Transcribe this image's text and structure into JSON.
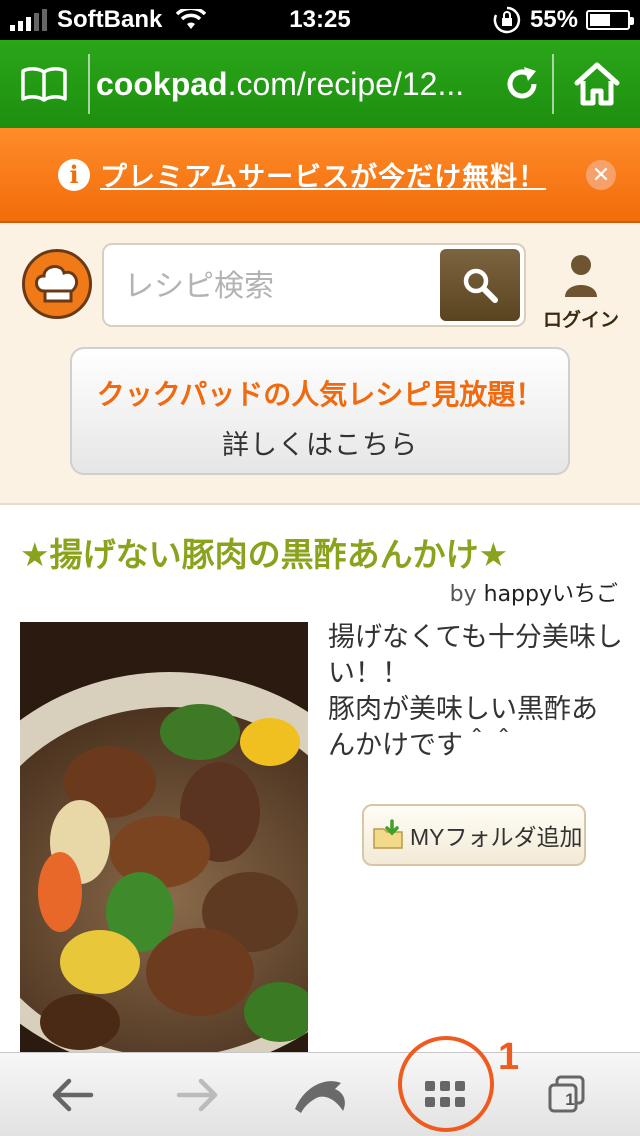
{
  "status_bar": {
    "carrier": "SoftBank",
    "time": "13:25",
    "battery_percent": "55%",
    "battery_level": 0.55
  },
  "browser": {
    "url_domain": "cookpad",
    "url_rest": ".com/recipe/12..."
  },
  "banner": {
    "text": "プレミアムサービスが今だけ無料！"
  },
  "header": {
    "search_placeholder": "レシピ検索",
    "login_label": "ログイン",
    "promo_line1": "クックパッドの人気レシピ見放題！",
    "promo_line2": "詳しくはこちら"
  },
  "recipe": {
    "title": "★揚げない豚肉の黒酢あんかけ★",
    "author_prefix": "by ",
    "author_name": "happyいちご",
    "description_line1": "揚げなくても十分美味しい！！",
    "description_line2": "豚肉が美味しい黒酢あんかけです＾＾",
    "folder_button": "MYフォルダ追加"
  },
  "toolbar": {
    "tab_count": "1"
  },
  "annotation": {
    "number": "1",
    "color": "#f05a1e"
  },
  "colors": {
    "brand_green": "#1d8f0f",
    "banner_orange": "#f26c0a",
    "title_green": "#8aa31c",
    "promo_orange": "#f06a10"
  }
}
